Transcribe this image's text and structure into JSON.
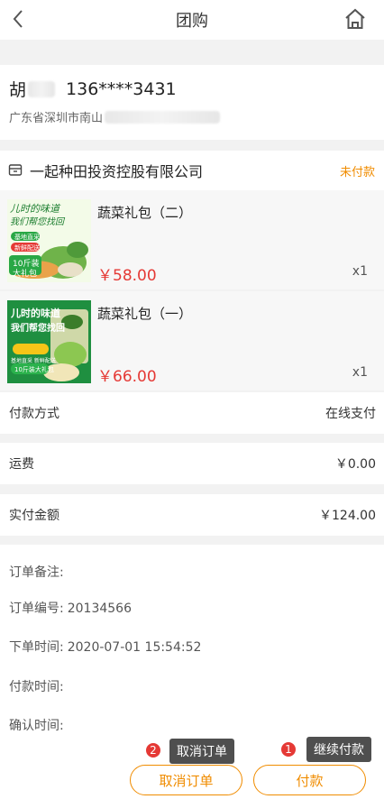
{
  "header": {
    "title": "团购"
  },
  "address": {
    "name_visible": "胡",
    "phone": "136****3431",
    "address_visible": "广东省深圳市南山"
  },
  "shop": {
    "name": "一起种田投资控股有限公司",
    "status": "未付款"
  },
  "items": [
    {
      "name": "蔬菜礼包（二）",
      "price": "￥58.00",
      "qty": "x1",
      "thumb": {
        "line1": "儿时的味道",
        "line2": "我们帮您找回",
        "tag1": "基地直采",
        "tag2": "新鲜配送",
        "tag3": "10斤装",
        "tag4": "大礼包"
      }
    },
    {
      "name": "蔬菜礼包（一）",
      "price": "￥66.00",
      "qty": "x1",
      "thumb": {
        "line1": "儿时的味道",
        "line2": "我们帮您找回",
        "tag1": "基地直采 新鲜配送",
        "tag2": "10斤装大礼包"
      }
    }
  ],
  "payment": {
    "label": "付款方式",
    "value": "在线支付"
  },
  "shipping": {
    "label": "运费",
    "value": "￥0.00"
  },
  "total": {
    "label": "实付金额",
    "value": "￥124.00"
  },
  "details": {
    "remark_label": "订单备注:",
    "order_no_label": "订单编号:",
    "order_no": "20134566",
    "order_time_label": "下单时间:",
    "order_time": "2020-07-01 15:54:52",
    "pay_time_label": "付款时间:",
    "confirm_time_label": "确认时间:"
  },
  "footer": {
    "cancel_label": "取消订单",
    "pay_label": "付款"
  },
  "tooltips": [
    {
      "badge": "2",
      "text": "取消订单"
    },
    {
      "badge": "1",
      "text": "继续付款"
    }
  ],
  "colors": {
    "accent": "#f08c00",
    "price": "#e53935",
    "background": "#f2f2f2"
  }
}
